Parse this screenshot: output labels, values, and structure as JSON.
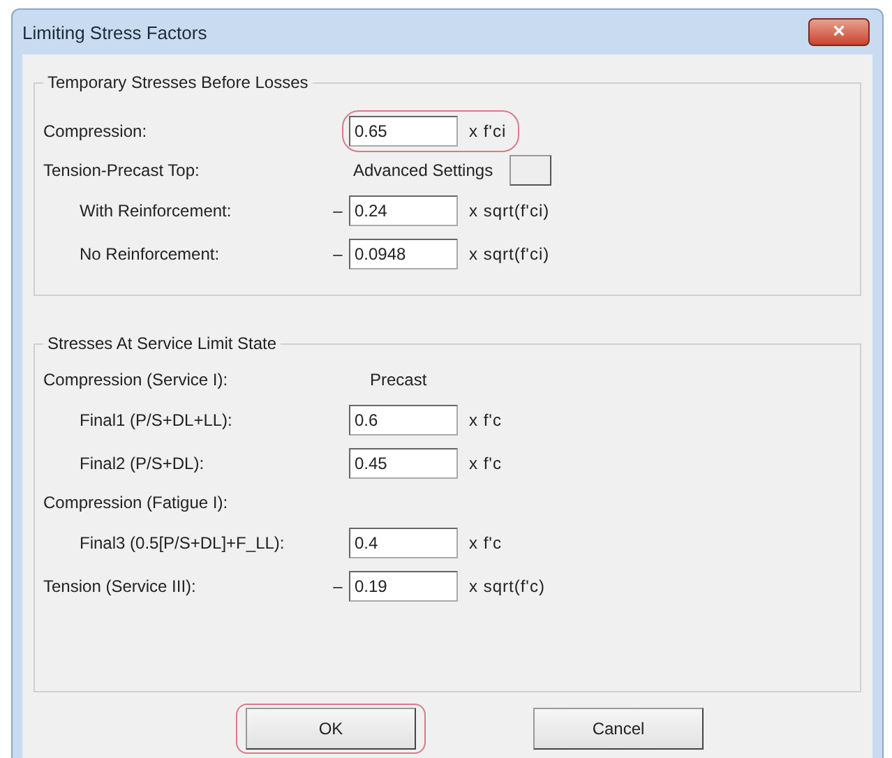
{
  "window": {
    "title": "Limiting Stress Factors",
    "close": "×"
  },
  "groups": [
    {
      "title": "Temporary Stresses Before Losses",
      "rows": [
        {
          "kind": "field",
          "label": "Compression:",
          "indented": false,
          "sign": "",
          "value": "0.65",
          "unit": "x f'ci",
          "highlighted": true
        },
        {
          "kind": "heading",
          "label": "Tension-Precast Top:",
          "indented": false,
          "extra": "Advanced Settings",
          "has_button": true
        },
        {
          "kind": "field",
          "label": "With Reinforcement:",
          "indented": true,
          "sign": "–",
          "value": "0.24",
          "unit": "x sqrt(f'ci)",
          "highlighted": false
        },
        {
          "kind": "field",
          "label": "No Reinforcement:",
          "indented": true,
          "sign": "–",
          "value": "0.0948",
          "unit": "x sqrt(f'ci)",
          "highlighted": false
        }
      ]
    },
    {
      "title": "Stresses At Service Limit State",
      "rows": [
        {
          "kind": "heading",
          "label": "Compression (Service I):",
          "indented": false,
          "extra": "Precast",
          "has_button": false
        },
        {
          "kind": "field",
          "label": "Final1 (P/S+DL+LL):",
          "indented": true,
          "sign": "",
          "value": "0.6",
          "unit": "x f'c",
          "highlighted": false
        },
        {
          "kind": "field",
          "label": "Final2 (P/S+DL):",
          "indented": true,
          "sign": "",
          "value": "0.45",
          "unit": "x f'c",
          "highlighted": false
        },
        {
          "kind": "heading",
          "label": "Compression (Fatigue I):",
          "indented": false,
          "extra": "",
          "has_button": false
        },
        {
          "kind": "field",
          "label": "Final3 (0.5[P/S+DL]+F_LL):",
          "indented": true,
          "sign": "",
          "value": "0.4",
          "unit": "x f'c",
          "highlighted": false
        },
        {
          "kind": "field",
          "label": "Tension (Service III):",
          "indented": false,
          "sign": "–",
          "value": "0.19",
          "unit": "x sqrt(f'c)",
          "highlighted": false
        }
      ]
    }
  ],
  "buttons": [
    {
      "label": "OK",
      "highlighted": true
    },
    {
      "label": "Cancel",
      "highlighted": false
    }
  ]
}
